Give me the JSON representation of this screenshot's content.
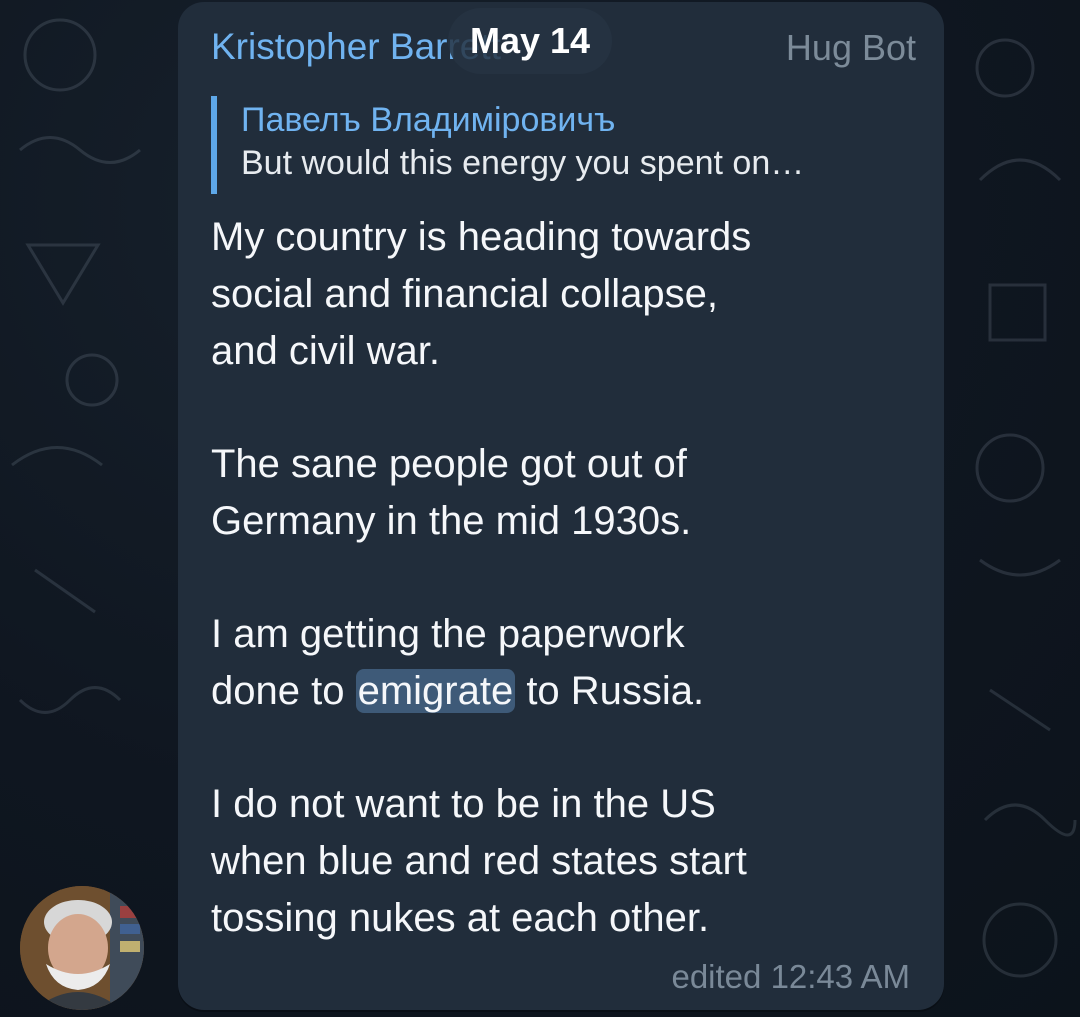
{
  "chat": {
    "date_label": "May 14"
  },
  "message": {
    "sender": "Kristopher Barrett",
    "via_bot": "Hug Bot",
    "reply": {
      "author": "Павелъ Владиміровичъ",
      "preview": "But would this energy you spent on…"
    },
    "body": {
      "p1": [
        "My country is heading towards",
        "social and financial collapse,",
        "and civil war."
      ],
      "p2": [
        "The sane people got out of",
        "Germany in the mid 1930s."
      ],
      "p3": {
        "line1": "I am getting the paperwork",
        "line2_pre": "done to ",
        "highlight": "emigrate",
        "line2_post": " to Russia."
      },
      "p4": [
        "I do not want to be in the US",
        "when blue and red states start",
        "tossing nukes at each other."
      ]
    },
    "meta": {
      "status": "edited",
      "time": "12:43 AM"
    }
  },
  "icons": {
    "avatar": "user-avatar-photo",
    "background": "doodle-pattern"
  },
  "colors": {
    "background": "#0f1620",
    "bubble": "#212d3b",
    "accent": "#70b3f0",
    "reply_bar": "#5ea7e8",
    "highlight": "#3e5a78"
  }
}
